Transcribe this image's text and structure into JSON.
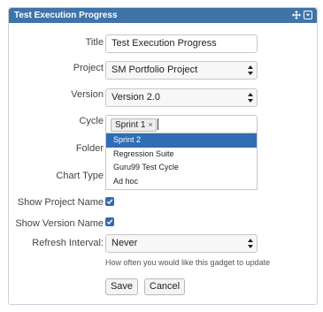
{
  "gadget": {
    "title": "Test Execution Progress",
    "icons": [
      "move-icon",
      "menu-dropdown-icon"
    ]
  },
  "form": {
    "title": {
      "label": "Title",
      "value": "Test Execution Progress"
    },
    "project": {
      "label": "Project",
      "value": "SM Portfolio Project"
    },
    "version": {
      "label": "Version",
      "value": "Version 2.0"
    },
    "cycle": {
      "label": "Cycle",
      "selected_tag": "Sprint 1",
      "remove_glyph": "×",
      "options": [
        "Sprint 2",
        "Regression Suite",
        "Guru99 Test Cycle",
        "Ad hoc"
      ],
      "highlighted_option": "Sprint 2"
    },
    "folder": {
      "label": "Folder"
    },
    "chart_type": {
      "label": "Chart Type"
    },
    "show_project_name": {
      "label": "Show Project Name",
      "checked": true
    },
    "show_version_name": {
      "label": "Show Version Name",
      "checked": true
    },
    "refresh_interval": {
      "label": "Refresh Interval:",
      "value": "Never",
      "help": "How often you would like this gadget to update"
    },
    "buttons": {
      "save": "Save",
      "cancel": "Cancel"
    }
  },
  "colors": {
    "header": "#3f74a8",
    "accent": "#2f6db5"
  }
}
